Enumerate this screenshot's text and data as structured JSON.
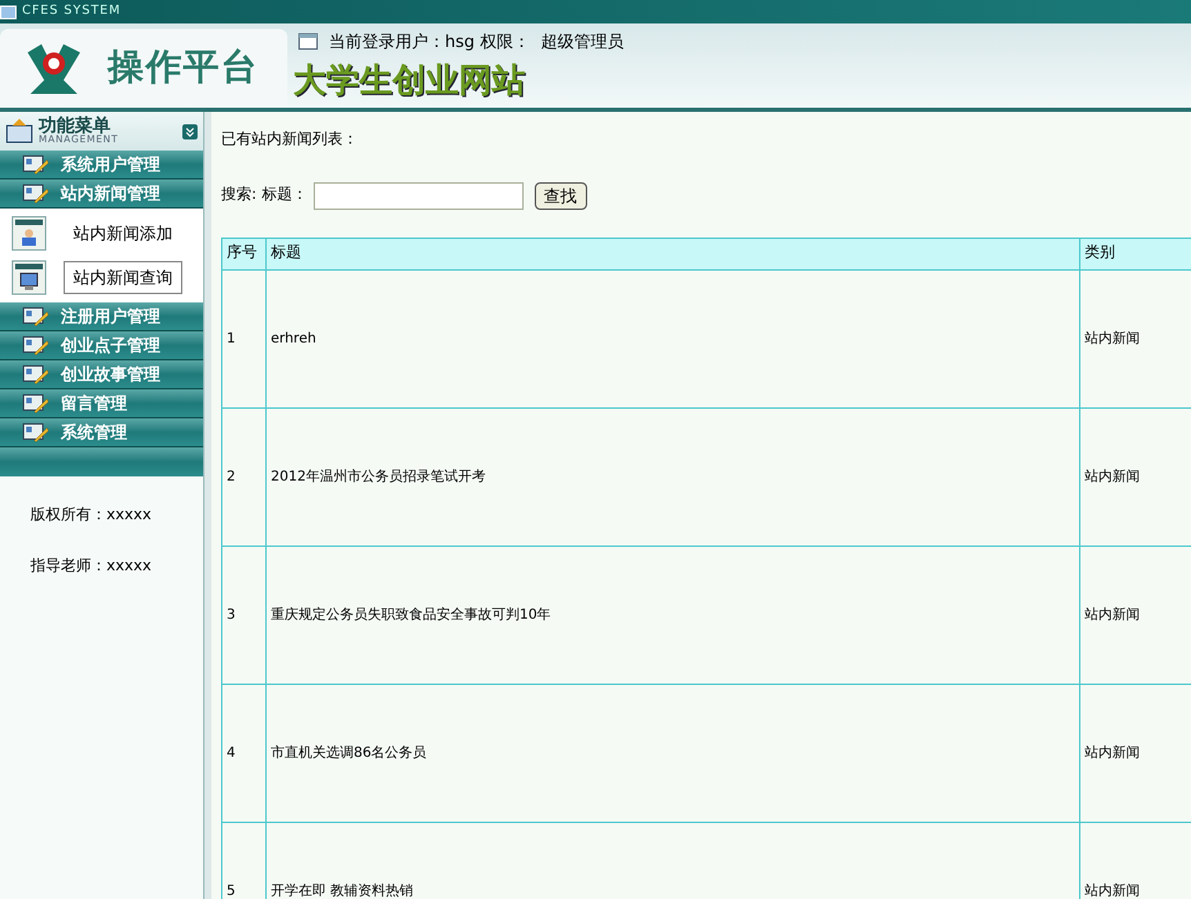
{
  "window": {
    "title": "CFES SYSTEM"
  },
  "header": {
    "brand": "操作平台",
    "user_label": "当前登录用户：hsg 权限：",
    "role": "超级管理员",
    "site_title": "大学生创业网站"
  },
  "sidebar": {
    "title": "功能菜单",
    "subtitle": "MANAGEMENT",
    "items": [
      {
        "label": "系统用户管理"
      },
      {
        "label": "站内新闻管理",
        "children": [
          {
            "label": "站内新闻添加",
            "kind": "person",
            "selected": false
          },
          {
            "label": "站内新闻查询",
            "kind": "monitor",
            "selected": true
          }
        ]
      },
      {
        "label": "注册用户管理"
      },
      {
        "label": "创业点子管理"
      },
      {
        "label": "创业故事管理"
      },
      {
        "label": "留言管理"
      },
      {
        "label": "系统管理"
      }
    ],
    "footer": [
      "版权所有：xxxxx",
      "指导老师：xxxxx"
    ]
  },
  "main": {
    "heading": "已有站内新闻列表：",
    "search": {
      "prefix": "搜索:",
      "label": "标题：",
      "button": "查找"
    },
    "table": {
      "columns": [
        "序号",
        "标题",
        "类别"
      ],
      "rows": [
        [
          "1",
          "erhreh",
          "站内新闻"
        ],
        [
          "2",
          "2012年温州市公务员招录笔试开考",
          "站内新闻"
        ],
        [
          "3",
          "重庆规定公务员失职致食品安全事故可判10年",
          "站内新闻"
        ],
        [
          "4",
          "市直机关选调86名公务员",
          "站内新闻"
        ],
        [
          "5",
          "开学在即 教辅资料热销",
          "站内新闻"
        ]
      ]
    }
  }
}
